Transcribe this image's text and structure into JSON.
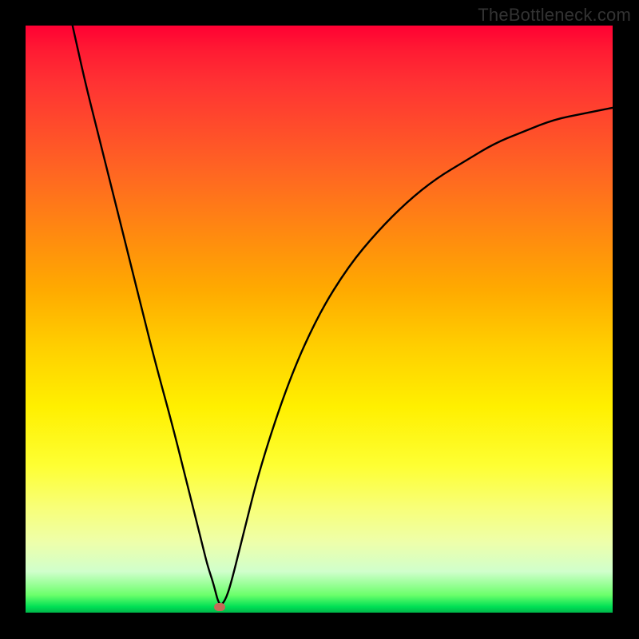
{
  "watermark": "TheBottleneck.com",
  "colors": {
    "frame": "#000000",
    "curve": "#000000",
    "marker": "#c56a58"
  },
  "chart_data": {
    "type": "line",
    "title": "",
    "xlabel": "",
    "ylabel": "",
    "xlim": [
      0,
      100
    ],
    "ylim": [
      0,
      100
    ],
    "grid": false,
    "legend": false,
    "annotations": [
      {
        "text": "TheBottleneck.com",
        "position": "top-right"
      }
    ],
    "marker": {
      "x_pct": 33,
      "y_pct": 99
    },
    "series": [
      {
        "name": "bottleneck-curve",
        "x_pct": [
          8,
          10,
          12,
          15,
          18,
          20,
          22,
          25,
          28,
          30,
          31,
          32,
          33,
          34,
          35,
          37,
          40,
          45,
          50,
          55,
          60,
          65,
          70,
          75,
          80,
          85,
          90,
          95,
          100
        ],
        "y_pct": [
          0,
          9,
          17,
          29,
          41,
          49,
          57,
          68,
          80,
          88,
          92,
          95,
          99,
          98,
          95,
          87,
          75,
          60,
          49,
          41,
          35,
          30,
          26,
          23,
          20,
          18,
          16,
          15,
          14
        ]
      }
    ]
  }
}
